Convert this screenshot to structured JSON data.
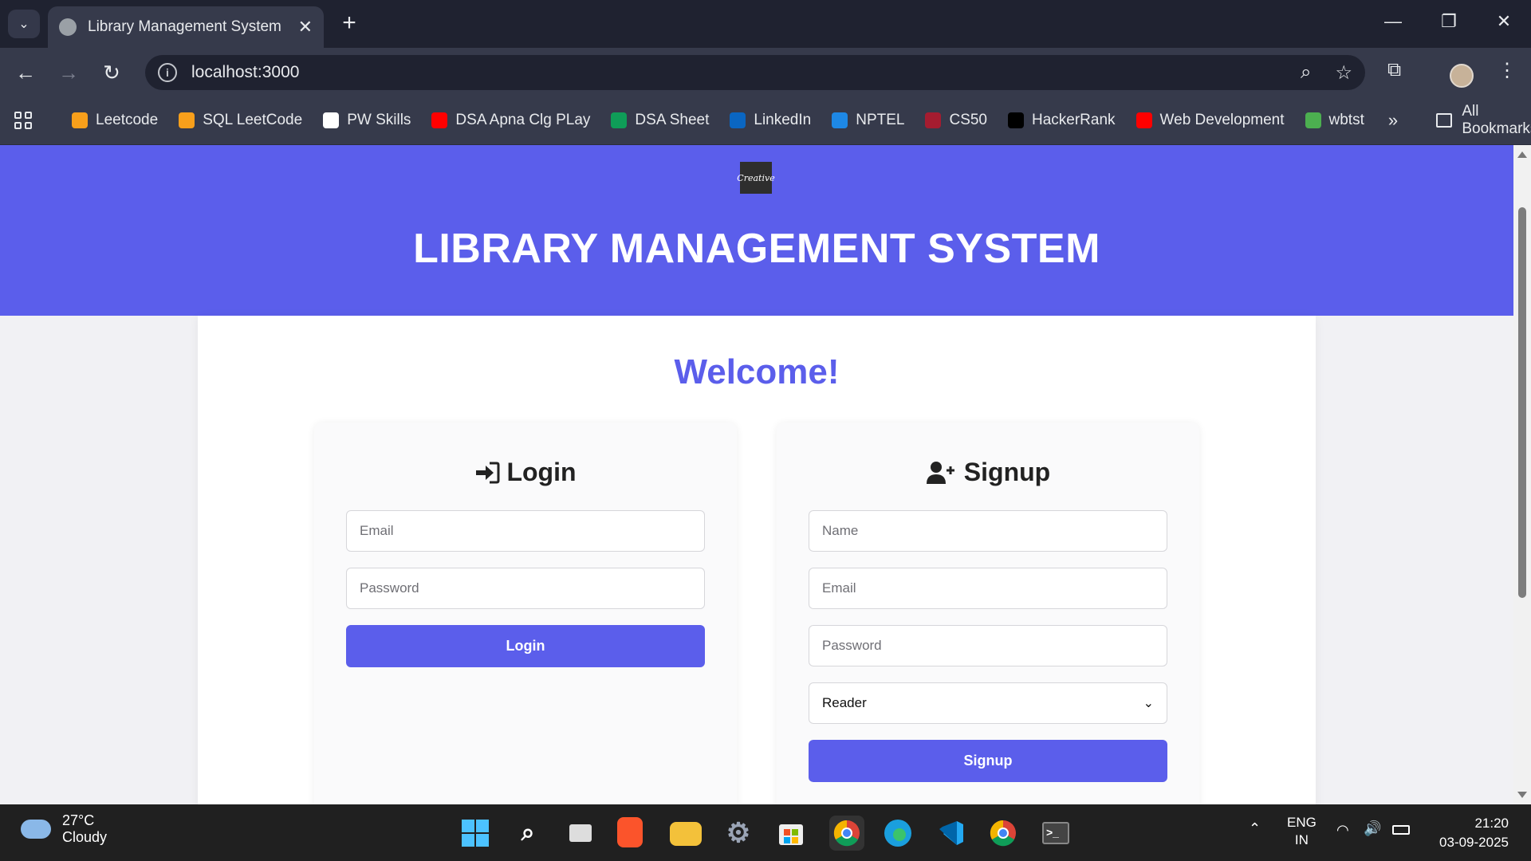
{
  "browser": {
    "tab_title": "Library Management System",
    "url": "localhost:3000",
    "bookmarks": [
      {
        "label": "Leetcode",
        "icon": "leetcode-icon",
        "color": "#f89f1b"
      },
      {
        "label": "SQL LeetCode",
        "icon": "leetcode-icon",
        "color": "#f89f1b"
      },
      {
        "label": "PW Skills",
        "icon": "pwskills-icon",
        "color": "#ffffff"
      },
      {
        "label": "DSA Apna Clg PLay",
        "icon": "youtube-icon",
        "color": "#ff0000"
      },
      {
        "label": "DSA Sheet",
        "icon": "sheets-icon",
        "color": "#0f9d58"
      },
      {
        "label": "LinkedIn",
        "icon": "linkedin-icon",
        "color": "#0a66c2"
      },
      {
        "label": "NPTEL",
        "icon": "nptel-icon",
        "color": "#1e88e5"
      },
      {
        "label": "CS50",
        "icon": "harvard-icon",
        "color": "#a51c30"
      },
      {
        "label": "HackerRank",
        "icon": "hackerrank-icon",
        "color": "#000000"
      },
      {
        "label": "Web Development",
        "icon": "youtube-icon",
        "color": "#ff0000"
      },
      {
        "label": "wbtst",
        "icon": "wbtst-icon",
        "color": "#4caf50"
      }
    ],
    "all_bookmarks_label": "All Bookmarks"
  },
  "page": {
    "logo_text": "Creative",
    "header_title": "LIBRARY MANAGEMENT SYSTEM",
    "welcome": "Welcome!",
    "accent_color": "#5b5eeb",
    "login": {
      "title": "Login",
      "email_placeholder": "Email",
      "password_placeholder": "Password",
      "button": "Login"
    },
    "signup": {
      "title": "Signup",
      "name_placeholder": "Name",
      "email_placeholder": "Email",
      "password_placeholder": "Password",
      "role_selected": "Reader",
      "button": "Signup"
    }
  },
  "taskbar": {
    "temperature": "27°C",
    "weather": "Cloudy",
    "lang_top": "ENG",
    "lang_bottom": "IN",
    "time": "21:20",
    "date": "03-09-2025"
  }
}
